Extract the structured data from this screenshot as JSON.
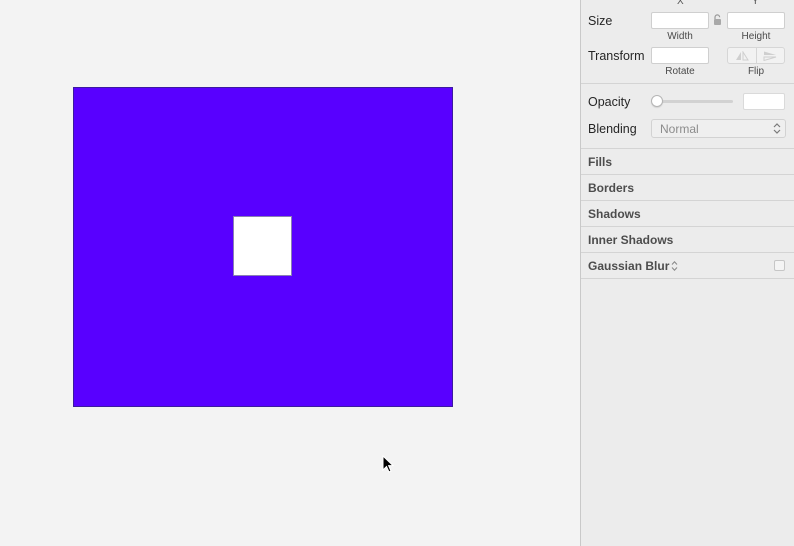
{
  "colors": {
    "artboard_fill": "#5800ff",
    "inner_rect_fill": "#ffffff",
    "canvas_bg": "#f3f3f3",
    "inspector_bg": "#ececec"
  },
  "inspector": {
    "position": {
      "x_label": "X",
      "y_label": "Y"
    },
    "size": {
      "label": "Size",
      "width_label": "Width",
      "height_label": "Height",
      "width_value": "",
      "height_value": ""
    },
    "transform": {
      "label": "Transform",
      "rotate_label": "Rotate",
      "flip_label": "Flip",
      "rotate_value": ""
    },
    "opacity": {
      "label": "Opacity",
      "value": ""
    },
    "blending": {
      "label": "Blending",
      "value": "Normal"
    },
    "sections": {
      "fills": "Fills",
      "borders": "Borders",
      "shadows": "Shadows",
      "inner_shadows": "Inner Shadows",
      "gaussian_blur": "Gaussian Blur"
    }
  }
}
